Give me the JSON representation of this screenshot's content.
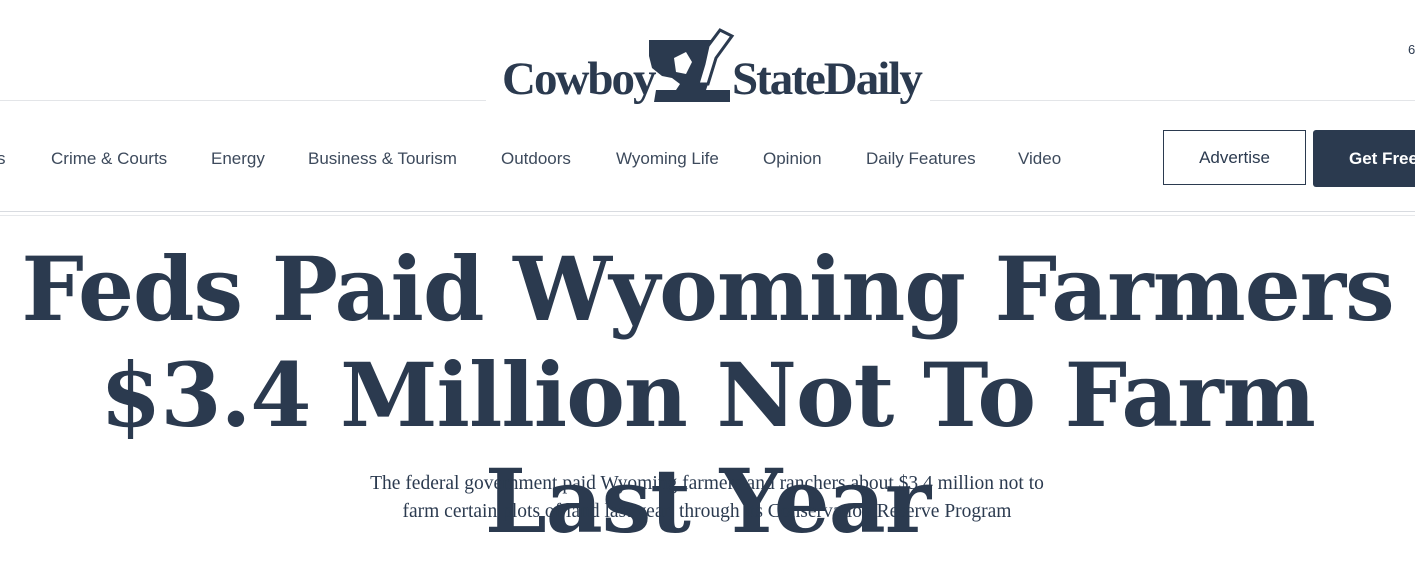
{
  "brand": {
    "name_left": "Cowboy",
    "name_right": "StateDaily",
    "logo_icon": "wyoming-state-bucking-horse-icon",
    "color": "#2b3a4f"
  },
  "header": {
    "corner_text": "6"
  },
  "nav": {
    "items": [
      {
        "label": "s"
      },
      {
        "label": "Crime & Courts"
      },
      {
        "label": "Energy"
      },
      {
        "label": "Business & Tourism"
      },
      {
        "label": "Outdoors"
      },
      {
        "label": "Wyoming Life"
      },
      {
        "label": "Opinion"
      },
      {
        "label": "Daily Features"
      },
      {
        "label": "Video"
      }
    ],
    "advertise_label": "Advertise",
    "get_free_label": "Get Free"
  },
  "article": {
    "headline": "Feds Paid Wyoming Farmers $3.4 Million Not To Farm Last Year",
    "dek": "The federal government paid Wyoming farmers and ranchers about $3.4 million not to farm certain plots of land last year, through its Conservation Reserve Program"
  }
}
